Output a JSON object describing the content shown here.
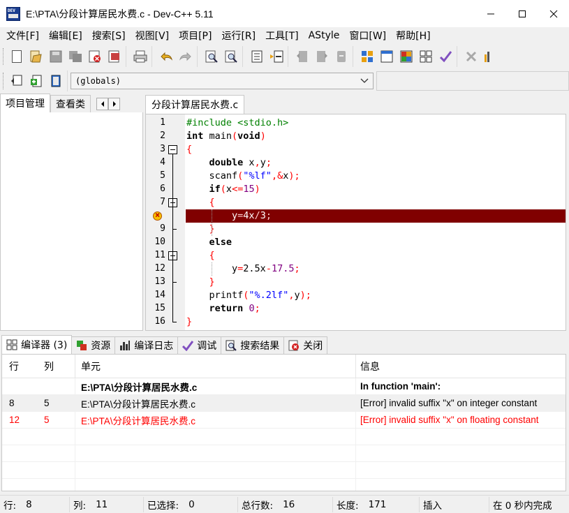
{
  "window": {
    "title": "E:\\PTA\\分段计算居民水费.c - Dev-C++ 5.11",
    "minimize_icon": "minimize-icon",
    "maximize_icon": "maximize-icon",
    "close_icon": "close-icon"
  },
  "menu": [
    "文件[F]",
    "编辑[E]",
    "搜索[S]",
    "视图[V]",
    "项目[P]",
    "运行[R]",
    "工具[T]",
    "AStyle",
    "窗口[W]",
    "帮助[H]"
  ],
  "toolbar2": {
    "scope_value": "(globals)"
  },
  "left_panel": {
    "tabs": [
      "项目管理",
      "查看类"
    ]
  },
  "editor": {
    "tab": "分段计算居民水费.c",
    "line_numbers": [
      "1",
      "2",
      "3",
      "4",
      "5",
      "6",
      "7",
      "8",
      "9",
      "10",
      "11",
      "12",
      "13",
      "14",
      "15",
      "16"
    ],
    "colors": {
      "error_line_bg": "#800000",
      "keyword": "#000000",
      "preprocessor": "#008000",
      "symbol": "#ff0000",
      "string": "#0000ff",
      "number": "#800080"
    }
  },
  "bottom_tabs": [
    "编译器 (3)",
    "资源",
    "编译日志",
    "调试",
    "搜索结果",
    "关闭"
  ],
  "messages": {
    "headers": {
      "row": "行",
      "col": "列",
      "unit": "单元",
      "info": "信息"
    },
    "rows": [
      {
        "row": "",
        "col": "",
        "unit": "E:\\PTA\\分段计算居民水费.c",
        "info": "In function 'main':"
      },
      {
        "row": "8",
        "col": "5",
        "unit": "E:\\PTA\\分段计算居民水费.c",
        "info": "[Error] invalid suffix \"x\" on integer constant"
      },
      {
        "row": "12",
        "col": "5",
        "unit": "E:\\PTA\\分段计算居民水费.c",
        "info": "[Error] invalid suffix \"x\" on floating constant"
      }
    ]
  },
  "status": {
    "row_label": "行:",
    "row_value": "8",
    "col_label": "列:",
    "col_value": "11",
    "sel_label": "已选择:",
    "sel_value": "0",
    "lines_label": "总行数:",
    "lines_value": "16",
    "len_label": "长度:",
    "len_value": "171",
    "mode": "插入",
    "parse": "在 0 秒内完成"
  }
}
